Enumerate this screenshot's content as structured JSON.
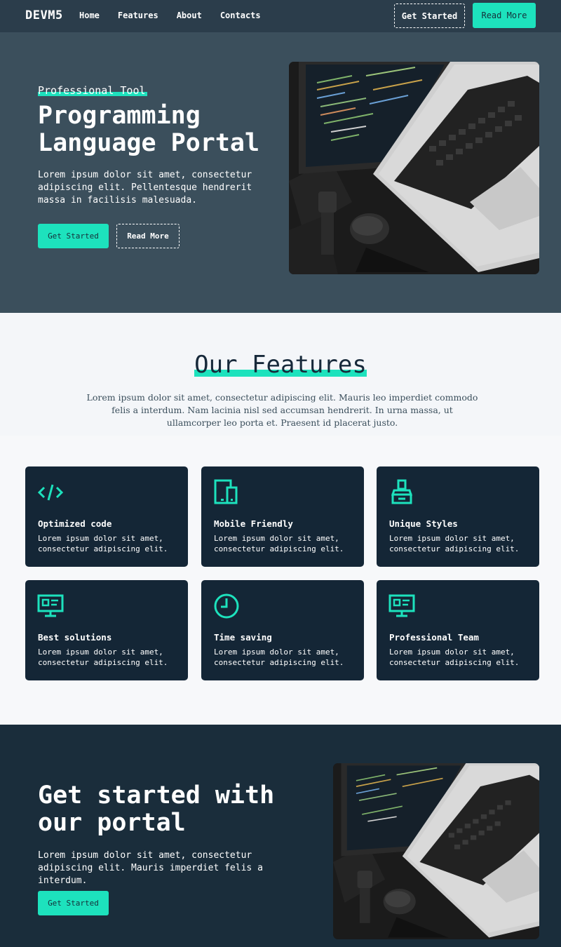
{
  "nav": {
    "logo": "DEVM5",
    "links": [
      "Home",
      "Features",
      "About",
      "Contacts"
    ],
    "btn_outline": "Get Started",
    "btn_fill": "Read More"
  },
  "hero": {
    "eyebrow": "Professional Tool",
    "title": "Programming Language Portal",
    "description": "Lorem ipsum dolor sit amet, consectetur adipiscing elit. Pellentesque hendrerit massa in facilisis malesuada.",
    "btn_primary": "Get Started",
    "btn_secondary": "Read More"
  },
  "features": {
    "title": "Our Features",
    "subtitle": "Lorem ipsum dolor sit amet, consectetur adipiscing elit. Mauris leo imperdiet commodo felis a interdum. Nam lacinia nisl sed accumsan hendrerit. In urna massa, ut ullamcorper leo porta et. Praesent id placerat justo.",
    "cards": [
      {
        "title": "Optimized code",
        "desc": "Lorem ipsum dolor sit amet, consectetur adipiscing elit.",
        "icon": "code-icon"
      },
      {
        "title": "Mobile Friendly",
        "desc": "Lorem ipsum dolor sit amet, consectetur adipiscing elit.",
        "icon": "devices-icon"
      },
      {
        "title": "Unique Styles",
        "desc": "Lorem ipsum dolor sit amet, consectetur adipiscing elit.",
        "icon": "paint-brush-icon"
      },
      {
        "title": "Best solutions",
        "desc": "Lorem ipsum dolor sit amet, consectetur adipiscing elit.",
        "icon": "monitor-icon"
      },
      {
        "title": "Time saving",
        "desc": "Lorem ipsum dolor sit amet, consectetur adipiscing elit.",
        "icon": "clock-icon"
      },
      {
        "title": "Professional Team",
        "desc": "Lorem ipsum dolor sit amet, consectetur adipiscing elit.",
        "icon": "monitor-icon"
      }
    ]
  },
  "cta": {
    "title": "Get started with our portal",
    "description": "Lorem ipsum dolor sit amet, consectetur adipiscing elit. Mauris imperdiet felis a interdum.",
    "btn": "Get Started"
  },
  "colors": {
    "accent": "#1de2bd",
    "nav_bg": "#2b3d4b",
    "hero_bg": "#3b4f5c",
    "card_bg": "#142636",
    "cta_bg": "#1a2d3b"
  }
}
